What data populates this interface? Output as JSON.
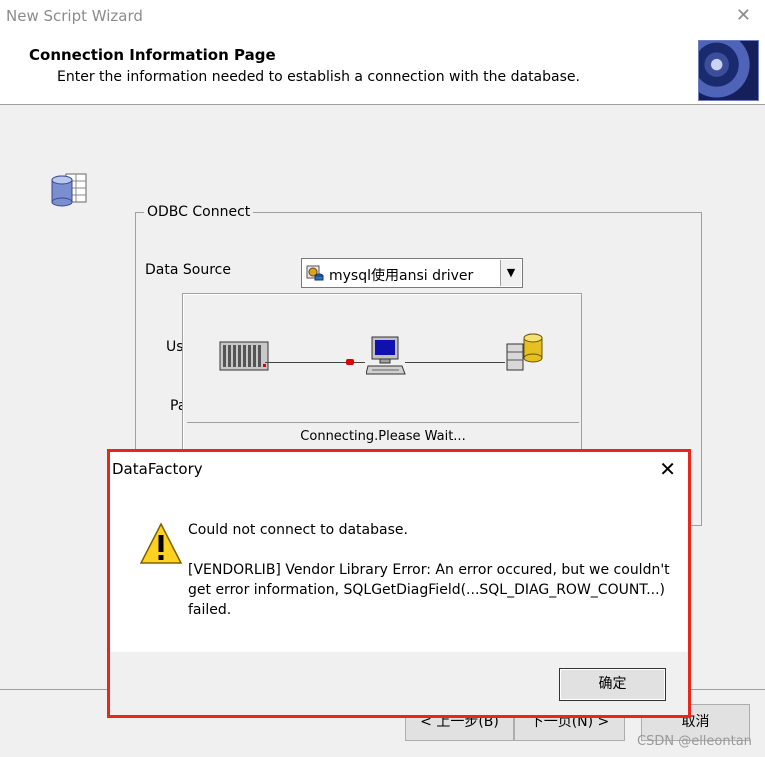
{
  "window": {
    "title": "New Script Wizard",
    "close_glyph": "✕"
  },
  "header": {
    "title": "Connection Information Page",
    "subtitle": "Enter the information needed to establish a connection with the database.",
    "image_icon": "gears-image"
  },
  "group": {
    "legend": "ODBC Connect",
    "data_source_label": "Data Source",
    "data_source_value": "mysql使用ansi driver",
    "user_label_partial": "Us",
    "password_label_partial": "Pa"
  },
  "progress": {
    "message": "Connecting.Please Wait...",
    "icons": [
      "server-rack-icon",
      "computer-icon",
      "database-icon"
    ]
  },
  "nav": {
    "back_label": "< 上一步(B)",
    "next_label": "下一页(N) >",
    "cancel_label": "取消"
  },
  "dialog": {
    "title": "DataFactory",
    "close_glyph": "✕",
    "message_line1": "Could not connect to database.",
    "message_line2": "[VENDORLIB] Vendor Library Error: An error occured, but we couldn't",
    "message_line3": "get error information, SQLGetDiagField(...SQL_DIAG_ROW_COUNT...)",
    "message_line4": "failed.",
    "ok_label": "确定",
    "highlight_color": "#e8261c"
  },
  "watermark": "CSDN @elleontan"
}
